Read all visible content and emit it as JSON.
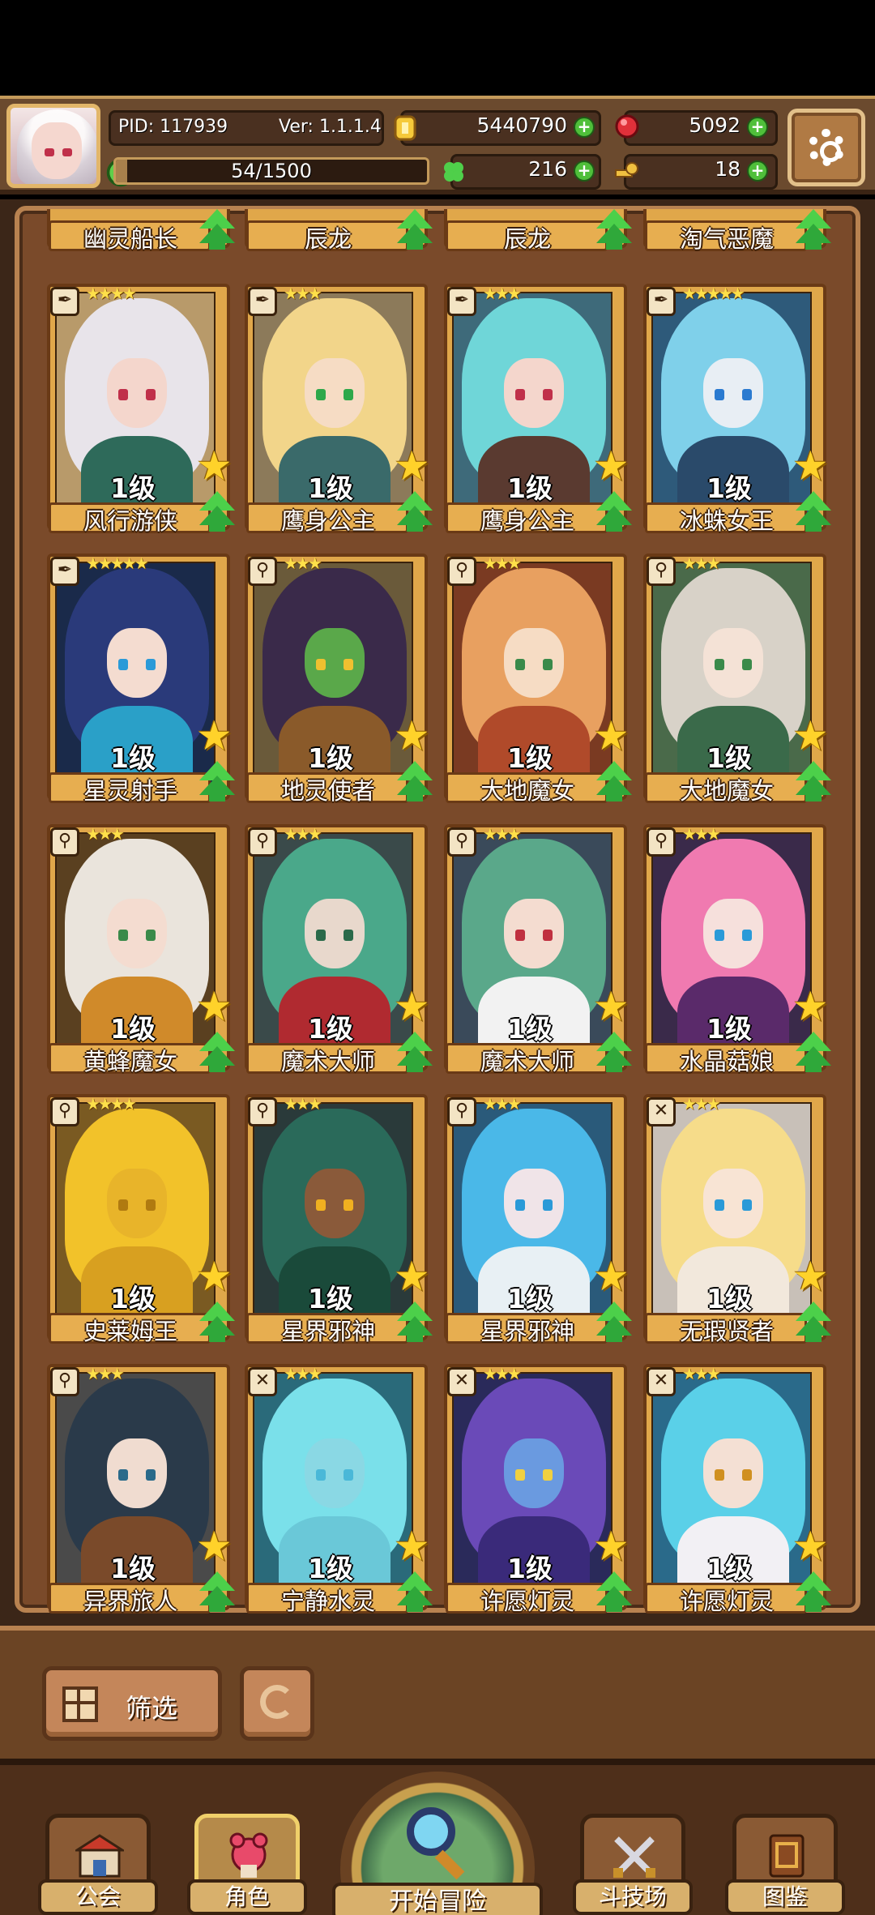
{
  "header": {
    "pid": "PID: 117939",
    "version": "Ver: 1.1.1.4",
    "gold": "5440790",
    "gems": "5092",
    "energy": "54/1500",
    "energy_fraction": 0.036,
    "clover": "216",
    "keys": "18",
    "icons": {
      "avatar": "player-avatar",
      "gold": "coin-icon",
      "gems": "ruby-icon",
      "energy": "leaf-icon",
      "clover": "clover-icon",
      "keys": "key-icon",
      "settings": "gear-icon"
    }
  },
  "top_row_names": [
    "幽灵船长",
    "辰龙",
    "辰龙",
    "淘气恶魔"
  ],
  "cards": [
    {
      "name": "风行游侠",
      "level": "1级",
      "stars": "★★★★",
      "class": "✒",
      "hair": "#e8e4ea",
      "skin": "#f4d6cc",
      "eye": "#c0304a",
      "outfit": "#2e6a5a",
      "bg": "#b89a6a"
    },
    {
      "name": "鹰身公主",
      "level": "1级",
      "stars": "★★★",
      "class": "✒",
      "hair": "#f2d58a",
      "skin": "#f6dcc4",
      "eye": "#2ea84a",
      "outfit": "#3a6a6a",
      "bg": "#8c7a5a"
    },
    {
      "name": "鹰身公主",
      "level": "1级",
      "stars": "★★★",
      "class": "✒",
      "hair": "#6fd6d8",
      "skin": "#f4d6cc",
      "eye": "#c0304a",
      "outfit": "#5a3a30",
      "bg": "#3e6a7a"
    },
    {
      "name": "冰蛛女王",
      "level": "1级",
      "stars": "★★★★★",
      "class": "✒",
      "hair": "#7fd0ea",
      "skin": "#e8eef4",
      "eye": "#2a7ad0",
      "outfit": "#2a4a6a",
      "bg": "#2e5a7a"
    },
    {
      "name": "星灵射手",
      "level": "1级",
      "stars": "★★★★★",
      "class": "✒",
      "hair": "#2a3a7a",
      "skin": "#f4dcd0",
      "eye": "#2a9ad8",
      "outfit": "#2aa0c8",
      "bg": "#1a2a4a"
    },
    {
      "name": "地灵使者",
      "level": "1级",
      "stars": "★★★",
      "class": "⚲",
      "hair": "#3a2a4a",
      "skin": "#5aa84a",
      "eye": "#f0c030",
      "outfit": "#8a5a2a",
      "bg": "#6a5a3a"
    },
    {
      "name": "大地魔女",
      "level": "1级",
      "stars": "★★★",
      "class": "⚲",
      "hair": "#e8a060",
      "skin": "#f6dcc4",
      "eye": "#3a8a4a",
      "outfit": "#b04a2a",
      "bg": "#7a3a22"
    },
    {
      "name": "大地魔女",
      "level": "1级",
      "stars": "★★★",
      "class": "⚲",
      "hair": "#d8d2c8",
      "skin": "#f4e2d6",
      "eye": "#3a8a4a",
      "outfit": "#3a6a4a",
      "bg": "#4a6a4a"
    },
    {
      "name": "黄蜂魔女",
      "level": "1级",
      "stars": "★★★",
      "class": "⚲",
      "hair": "#eae4dc",
      "skin": "#f4dcd0",
      "eye": "#3a8a4a",
      "outfit": "#d08a2a",
      "bg": "#5a4020"
    },
    {
      "name": "魔术大师",
      "level": "1级",
      "stars": "★★★",
      "class": "⚲",
      "hair": "#4aa88a",
      "skin": "#e8d8cc",
      "eye": "#2a6a4a",
      "outfit": "#b02a30",
      "bg": "#3a4a4a"
    },
    {
      "name": "魔术大师",
      "level": "1级",
      "stars": "★★★",
      "class": "⚲",
      "hair": "#5aa88a",
      "skin": "#f4dcd0",
      "eye": "#c03040",
      "outfit": "#f2f2f2",
      "bg": "#3a4a5a"
    },
    {
      "name": "水晶菇娘",
      "level": "1级",
      "stars": "★★★",
      "class": "⚲",
      "hair": "#f07ab0",
      "skin": "#f6e0dc",
      "eye": "#2a9ad8",
      "outfit": "#5a2a6a",
      "bg": "#3a2a4a"
    },
    {
      "name": "史莱姆王",
      "level": "1级",
      "stars": "★★★★",
      "class": "⚲",
      "hair": "#f2c22a",
      "skin": "#e8b42a",
      "eye": "#b07a10",
      "outfit": "#d8a020",
      "bg": "#7a5a22"
    },
    {
      "name": "星界邪神",
      "level": "1级",
      "stars": "★★★",
      "class": "⚲",
      "hair": "#2a6a5a",
      "skin": "#8a5a3a",
      "eye": "#f0b020",
      "outfit": "#1a4a3a",
      "bg": "#2a3a3a"
    },
    {
      "name": "星界邪神",
      "level": "1级",
      "stars": "★★★",
      "class": "⚲",
      "hair": "#4ab8e8",
      "skin": "#f0e4e8",
      "eye": "#2a9ad8",
      "outfit": "#e8f0f4",
      "bg": "#2a5a7a"
    },
    {
      "name": "无瑕贤者",
      "level": "1级",
      "stars": "★★★",
      "class": "✕",
      "hair": "#f6dc8a",
      "skin": "#f8e4d4",
      "eye": "#2a9ad8",
      "outfit": "#f2e8dc",
      "bg": "#c8c0b8"
    },
    {
      "name": "异界旅人",
      "level": "1级",
      "stars": "★★★",
      "class": "⚲",
      "hair": "#2a3a4a",
      "skin": "#f0dcd0",
      "eye": "#2a6a8a",
      "outfit": "#7a4a2a",
      "bg": "#4a4a4a"
    },
    {
      "name": "宁静水灵",
      "level": "1级",
      "stars": "★★★",
      "class": "✕",
      "hair": "#7ae0ea",
      "skin": "#8ad8e4",
      "eye": "#4ab8d8",
      "outfit": "#6ac8d8",
      "bg": "#2a6a7a"
    },
    {
      "name": "许愿灯灵",
      "level": "1级",
      "stars": "★★★",
      "class": "✕",
      "hair": "#6a4ab8",
      "skin": "#6a9ae0",
      "eye": "#f0d040",
      "outfit": "#3a2a7a",
      "bg": "#2a2a5a"
    },
    {
      "name": "许愿灯灵",
      "level": "1级",
      "stars": "★★★",
      "class": "✕",
      "hair": "#5ad0e8",
      "skin": "#f4e0d4",
      "eye": "#d09020",
      "outfit": "#f2f0f4",
      "bg": "#2a6a8a"
    }
  ],
  "filter": {
    "label": "筛选",
    "icons": {
      "filter": "grid-icon",
      "refresh": "refresh-icon"
    }
  },
  "nav": {
    "guild": "公会",
    "character": "角色",
    "adventure": "开始冒险",
    "arena": "斗技场",
    "codex": "图鉴",
    "active": "character"
  }
}
